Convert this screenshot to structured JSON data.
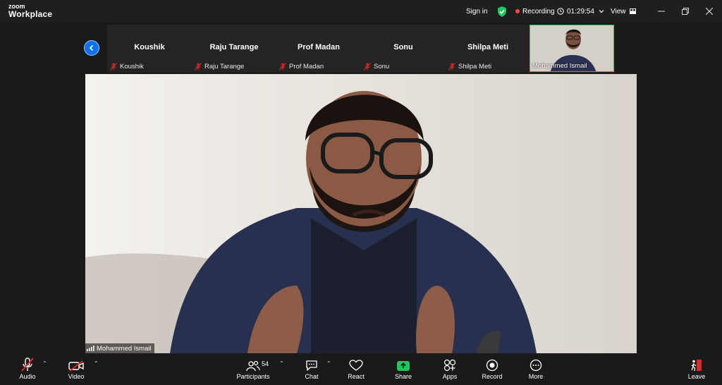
{
  "app": {
    "logo_top": "zoom",
    "logo_bottom": "Workplace"
  },
  "titlebar": {
    "sign_in": "Sign in",
    "recording": "Recording",
    "timer": "01:29:54",
    "view": "View"
  },
  "strip": {
    "participants": [
      {
        "name": "Koushik",
        "label": "Koushik"
      },
      {
        "name": "Raju Tarange",
        "label": "Raju Tarange"
      },
      {
        "name": "Prof Madan",
        "label": "Prof Madan"
      },
      {
        "name": "Sonu",
        "label": "Sonu"
      },
      {
        "name": "Shilpa Meti",
        "label": "Shilpa Meti"
      }
    ],
    "active_label": "Mohammed Ismail"
  },
  "main": {
    "speaker": "Mohammed Ismail"
  },
  "toolbar": {
    "audio": "Audio",
    "video": "Video",
    "participants": "Participants",
    "participant_count": "54",
    "chat": "Chat",
    "react": "React",
    "share": "Share",
    "apps": "Apps",
    "record": "Record",
    "more": "More",
    "leave": "Leave"
  },
  "colors": {
    "accent": "#0e72ed",
    "share": "#22c55e",
    "recording": "#ff4a4a",
    "muted": "#e02828"
  }
}
